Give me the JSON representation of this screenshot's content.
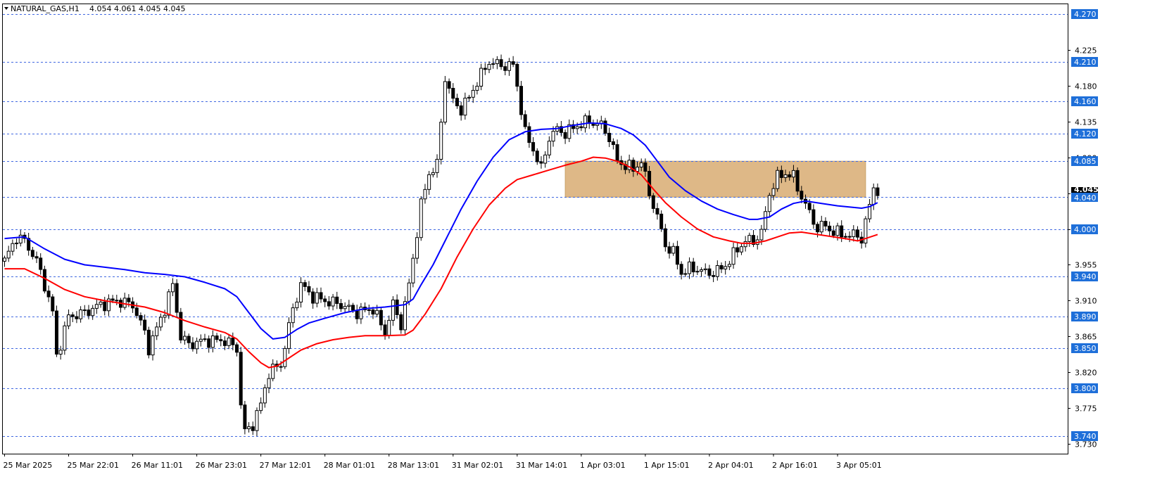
{
  "header": {
    "symbol": "NATURAL_GAS,H1",
    "ohlc": "4.054 4.061 4.045 4.045",
    "collapse_icon": "triangle-down-icon"
  },
  "colors": {
    "background": "#ffffff",
    "candle_up": "#ffffff",
    "candle_down": "#000000",
    "ma_fast": "#0000ff",
    "ma_slow": "#ff0000",
    "level_line": "#4169e1",
    "level_tag": "#1e6fd9",
    "price_tag": "#000000",
    "zone_fill": "#deb887"
  },
  "chart_data": {
    "type": "candlestick",
    "ylim": [
      3.718,
      4.282
    ],
    "price_ticks": [
      "4.225",
      "4.180",
      "4.135",
      "4.090",
      "4.045",
      "4.000",
      "3.955",
      "3.910",
      "3.865",
      "3.820",
      "3.775",
      "3.730"
    ],
    "level_lines": [
      "4.270",
      "4.210",
      "4.160",
      "4.120",
      "4.085",
      "4.040",
      "4.000",
      "3.940",
      "3.890",
      "3.850",
      "3.800",
      "3.740"
    ],
    "current_price": "4.045",
    "zone": {
      "from_index": 140,
      "to_index": 215,
      "low": 4.04,
      "high": 4.085
    },
    "time_labels": [
      {
        "i": 0,
        "label": "25 Mar 2025"
      },
      {
        "i": 16,
        "label": "25 Mar 22:01"
      },
      {
        "i": 32,
        "label": "26 Mar 11:01"
      },
      {
        "i": 48,
        "label": "26 Mar 23:01"
      },
      {
        "i": 64,
        "label": "27 Mar 12:01"
      },
      {
        "i": 80,
        "label": "28 Mar 01:01"
      },
      {
        "i": 96,
        "label": "28 Mar 13:01"
      },
      {
        "i": 112,
        "label": "31 Mar 02:01"
      },
      {
        "i": 128,
        "label": "31 Mar 14:01"
      },
      {
        "i": 144,
        "label": "1 Apr 03:01"
      },
      {
        "i": 160,
        "label": "1 Apr 15:01"
      },
      {
        "i": 176,
        "label": "2 Apr 04:01"
      },
      {
        "i": 192,
        "label": "2 Apr 16:01"
      },
      {
        "i": 208,
        "label": "3 Apr 05:01"
      }
    ],
    "close_anchors": [
      [
        0,
        3.96
      ],
      [
        3,
        3.99
      ],
      [
        5,
        3.985
      ],
      [
        8,
        3.96
      ],
      [
        10,
        3.93
      ],
      [
        12,
        3.895
      ],
      [
        13,
        3.84
      ],
      [
        16,
        3.89
      ],
      [
        20,
        3.895
      ],
      [
        24,
        3.905
      ],
      [
        28,
        3.91
      ],
      [
        32,
        3.905
      ],
      [
        35,
        3.87
      ],
      [
        36,
        3.85
      ],
      [
        40,
        3.9
      ],
      [
        42,
        3.93
      ],
      [
        44,
        3.865
      ],
      [
        46,
        3.855
      ],
      [
        50,
        3.86
      ],
      [
        55,
        3.86
      ],
      [
        58,
        3.85
      ],
      [
        59,
        3.78
      ],
      [
        60,
        3.745
      ],
      [
        62,
        3.755
      ],
      [
        64,
        3.78
      ],
      [
        66,
        3.82
      ],
      [
        69,
        3.83
      ],
      [
        72,
        3.9
      ],
      [
        74,
        3.93
      ],
      [
        77,
        3.915
      ],
      [
        80,
        3.91
      ],
      [
        84,
        3.905
      ],
      [
        88,
        3.895
      ],
      [
        92,
        3.9
      ],
      [
        95,
        3.87
      ],
      [
        97,
        3.905
      ],
      [
        99,
        3.88
      ],
      [
        101,
        3.93
      ],
      [
        104,
        4.03
      ],
      [
        106,
        4.07
      ],
      [
        108,
        4.08
      ],
      [
        110,
        4.19
      ],
      [
        112,
        4.16
      ],
      [
        114,
        4.15
      ],
      [
        116,
        4.165
      ],
      [
        118,
        4.185
      ],
      [
        121,
        4.21
      ],
      [
        124,
        4.205
      ],
      [
        127,
        4.205
      ],
      [
        128,
        4.18
      ],
      [
        130,
        4.12
      ],
      [
        132,
        4.1
      ],
      [
        134,
        4.075
      ],
      [
        136,
        4.115
      ],
      [
        138,
        4.125
      ],
      [
        140,
        4.12
      ],
      [
        143,
        4.13
      ],
      [
        146,
        4.135
      ],
      [
        149,
        4.13
      ],
      [
        151,
        4.115
      ],
      [
        153,
        4.085
      ],
      [
        155,
        4.08
      ],
      [
        157,
        4.075
      ],
      [
        159,
        4.085
      ],
      [
        161,
        4.045
      ],
      [
        163,
        4.015
      ],
      [
        165,
        3.98
      ],
      [
        167,
        3.97
      ],
      [
        169,
        3.945
      ],
      [
        171,
        3.95
      ],
      [
        173,
        3.95
      ],
      [
        175,
        3.945
      ],
      [
        177,
        3.945
      ],
      [
        179,
        3.95
      ],
      [
        181,
        3.96
      ],
      [
        183,
        3.975
      ],
      [
        185,
        3.985
      ],
      [
        187,
        3.985
      ],
      [
        189,
        3.995
      ],
      [
        191,
        4.045
      ],
      [
        193,
        4.065
      ],
      [
        195,
        4.07
      ],
      [
        197,
        4.065
      ],
      [
        199,
        4.04
      ],
      [
        201,
        4.02
      ],
      [
        203,
        4.0
      ],
      [
        205,
        4.005
      ],
      [
        207,
        3.995
      ],
      [
        209,
        3.995
      ],
      [
        211,
        3.99
      ],
      [
        213,
        3.995
      ],
      [
        214,
        3.985
      ],
      [
        216,
        4.03
      ],
      [
        217,
        4.055
      ],
      [
        218,
        4.045
      ]
    ],
    "ma_fast_points": [
      [
        0,
        3.988
      ],
      [
        5,
        3.99
      ],
      [
        10,
        3.975
      ],
      [
        15,
        3.962
      ],
      [
        20,
        3.955
      ],
      [
        25,
        3.952
      ],
      [
        30,
        3.949
      ],
      [
        35,
        3.945
      ],
      [
        40,
        3.943
      ],
      [
        45,
        3.94
      ],
      [
        50,
        3.933
      ],
      [
        55,
        3.925
      ],
      [
        58,
        3.915
      ],
      [
        61,
        3.895
      ],
      [
        64,
        3.875
      ],
      [
        67,
        3.862
      ],
      [
        70,
        3.864
      ],
      [
        73,
        3.874
      ],
      [
        76,
        3.882
      ],
      [
        80,
        3.888
      ],
      [
        85,
        3.895
      ],
      [
        90,
        3.9
      ],
      [
        95,
        3.902
      ],
      [
        100,
        3.905
      ],
      [
        102,
        3.912
      ],
      [
        104,
        3.93
      ],
      [
        107,
        3.955
      ],
      [
        110,
        3.985
      ],
      [
        114,
        4.025
      ],
      [
        118,
        4.06
      ],
      [
        122,
        4.09
      ],
      [
        126,
        4.112
      ],
      [
        130,
        4.122
      ],
      [
        134,
        4.125
      ],
      [
        138,
        4.126
      ],
      [
        142,
        4.13
      ],
      [
        146,
        4.133
      ],
      [
        150,
        4.132
      ],
      [
        154,
        4.126
      ],
      [
        157,
        4.118
      ],
      [
        160,
        4.105
      ],
      [
        163,
        4.085
      ],
      [
        166,
        4.065
      ],
      [
        170,
        4.048
      ],
      [
        174,
        4.035
      ],
      [
        178,
        4.025
      ],
      [
        182,
        4.018
      ],
      [
        186,
        4.012
      ],
      [
        188,
        4.012
      ],
      [
        191,
        4.015
      ],
      [
        194,
        4.025
      ],
      [
        197,
        4.032
      ],
      [
        200,
        4.035
      ],
      [
        204,
        4.032
      ],
      [
        208,
        4.029
      ],
      [
        212,
        4.027
      ],
      [
        214,
        4.026
      ],
      [
        216,
        4.028
      ],
      [
        218,
        4.033
      ]
    ],
    "ma_slow_points": [
      [
        0,
        3.95
      ],
      [
        5,
        3.95
      ],
      [
        10,
        3.938
      ],
      [
        15,
        3.924
      ],
      [
        20,
        3.915
      ],
      [
        25,
        3.91
      ],
      [
        30,
        3.906
      ],
      [
        35,
        3.902
      ],
      [
        40,
        3.895
      ],
      [
        45,
        3.885
      ],
      [
        50,
        3.877
      ],
      [
        55,
        3.87
      ],
      [
        58,
        3.862
      ],
      [
        61,
        3.846
      ],
      [
        64,
        3.832
      ],
      [
        66,
        3.826
      ],
      [
        68,
        3.828
      ],
      [
        71,
        3.838
      ],
      [
        74,
        3.848
      ],
      [
        78,
        3.856
      ],
      [
        82,
        3.861
      ],
      [
        86,
        3.864
      ],
      [
        90,
        3.866
      ],
      [
        95,
        3.866
      ],
      [
        100,
        3.867
      ],
      [
        102,
        3.873
      ],
      [
        105,
        3.893
      ],
      [
        109,
        3.925
      ],
      [
        113,
        3.965
      ],
      [
        117,
        4.0
      ],
      [
        121,
        4.03
      ],
      [
        125,
        4.051
      ],
      [
        128,
        4.062
      ],
      [
        132,
        4.068
      ],
      [
        136,
        4.074
      ],
      [
        140,
        4.08
      ],
      [
        144,
        4.085
      ],
      [
        147,
        4.09
      ],
      [
        150,
        4.089
      ],
      [
        153,
        4.085
      ],
      [
        156,
        4.078
      ],
      [
        159,
        4.068
      ],
      [
        162,
        4.05
      ],
      [
        165,
        4.033
      ],
      [
        169,
        4.015
      ],
      [
        173,
        4.0
      ],
      [
        177,
        3.99
      ],
      [
        181,
        3.985
      ],
      [
        184,
        3.982
      ],
      [
        187,
        3.982
      ],
      [
        190,
        3.985
      ],
      [
        193,
        3.99
      ],
      [
        196,
        3.995
      ],
      [
        199,
        3.996
      ],
      [
        203,
        3.993
      ],
      [
        207,
        3.99
      ],
      [
        211,
        3.987
      ],
      [
        213,
        3.985
      ],
      [
        215,
        3.988
      ],
      [
        218,
        3.993
      ]
    ]
  }
}
